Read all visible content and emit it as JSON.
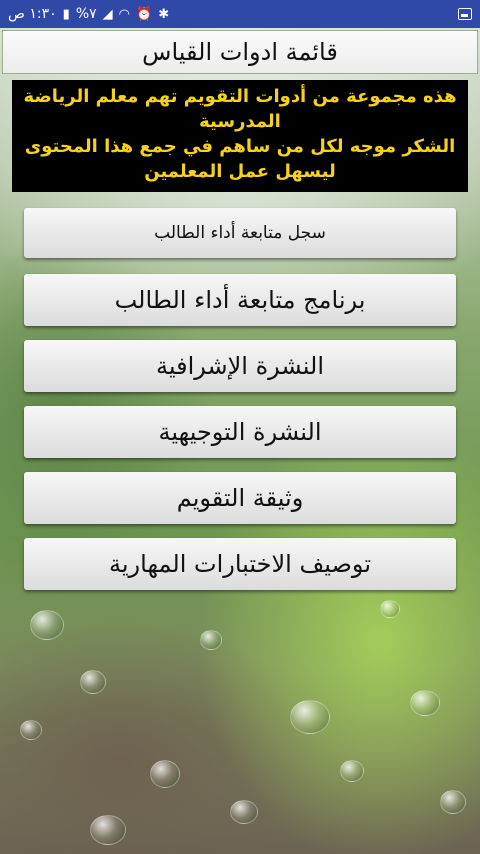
{
  "status_bar": {
    "time": "١:٣٠ ص",
    "battery": "%٧",
    "bg_color": "#3048a8"
  },
  "title": "قائمة ادوات القياس",
  "banner": {
    "line1": "هذه مجموعة من أدوات التقويم تهم معلم الرياضة",
    "line2": "المدرسية",
    "line3": "الشكر موجه لكل من ساهم في جمع هذا المحتوى",
    "line4": "ليسهل عمل المعلمين",
    "text_color": "#f6d21a"
  },
  "menu": [
    {
      "label": "سجل متابعة أداء الطالب"
    },
    {
      "label": "برنامج متابعة أداء الطالب"
    },
    {
      "label": "النشرة الإشرافية"
    },
    {
      "label": "النشرة التوجيهية"
    },
    {
      "label": "وثيقة التقويم"
    },
    {
      "label": "توصيف الاختبارات المهارية"
    }
  ]
}
